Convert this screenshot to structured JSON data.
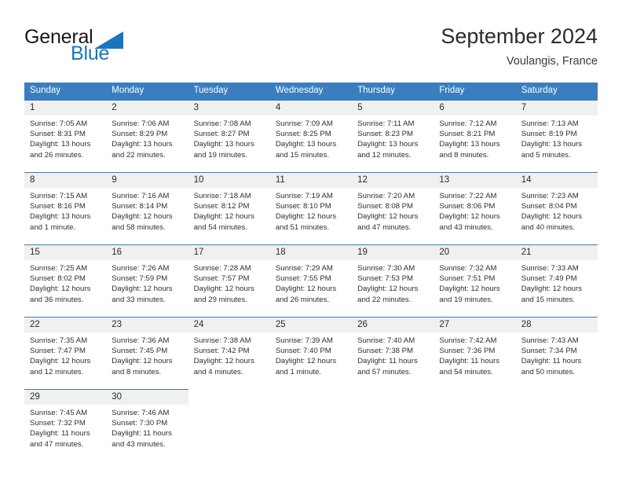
{
  "brand": {
    "name_part1": "General",
    "name_part2": "Blue",
    "logo_icon": "triangle-logo-icon",
    "accent_color": "#1b74bd"
  },
  "header": {
    "title": "September 2024",
    "location": "Voulangis, France"
  },
  "calendar": {
    "header_bg": "#3a7ebf",
    "daynum_bg": "#f0f0f0",
    "weekday_headers": [
      "Sunday",
      "Monday",
      "Tuesday",
      "Wednesday",
      "Thursday",
      "Friday",
      "Saturday"
    ],
    "weeks": [
      [
        {
          "day": "1",
          "sunrise": "Sunrise: 7:05 AM",
          "sunset": "Sunset: 8:31 PM",
          "daylight_line1": "Daylight: 13 hours",
          "daylight_line2": "and 26 minutes."
        },
        {
          "day": "2",
          "sunrise": "Sunrise: 7:06 AM",
          "sunset": "Sunset: 8:29 PM",
          "daylight_line1": "Daylight: 13 hours",
          "daylight_line2": "and 22 minutes."
        },
        {
          "day": "3",
          "sunrise": "Sunrise: 7:08 AM",
          "sunset": "Sunset: 8:27 PM",
          "daylight_line1": "Daylight: 13 hours",
          "daylight_line2": "and 19 minutes."
        },
        {
          "day": "4",
          "sunrise": "Sunrise: 7:09 AM",
          "sunset": "Sunset: 8:25 PM",
          "daylight_line1": "Daylight: 13 hours",
          "daylight_line2": "and 15 minutes."
        },
        {
          "day": "5",
          "sunrise": "Sunrise: 7:11 AM",
          "sunset": "Sunset: 8:23 PM",
          "daylight_line1": "Daylight: 13 hours",
          "daylight_line2": "and 12 minutes."
        },
        {
          "day": "6",
          "sunrise": "Sunrise: 7:12 AM",
          "sunset": "Sunset: 8:21 PM",
          "daylight_line1": "Daylight: 13 hours",
          "daylight_line2": "and 8 minutes."
        },
        {
          "day": "7",
          "sunrise": "Sunrise: 7:13 AM",
          "sunset": "Sunset: 8:19 PM",
          "daylight_line1": "Daylight: 13 hours",
          "daylight_line2": "and 5 minutes."
        }
      ],
      [
        {
          "day": "8",
          "sunrise": "Sunrise: 7:15 AM",
          "sunset": "Sunset: 8:16 PM",
          "daylight_line1": "Daylight: 13 hours",
          "daylight_line2": "and 1 minute."
        },
        {
          "day": "9",
          "sunrise": "Sunrise: 7:16 AM",
          "sunset": "Sunset: 8:14 PM",
          "daylight_line1": "Daylight: 12 hours",
          "daylight_line2": "and 58 minutes."
        },
        {
          "day": "10",
          "sunrise": "Sunrise: 7:18 AM",
          "sunset": "Sunset: 8:12 PM",
          "daylight_line1": "Daylight: 12 hours",
          "daylight_line2": "and 54 minutes."
        },
        {
          "day": "11",
          "sunrise": "Sunrise: 7:19 AM",
          "sunset": "Sunset: 8:10 PM",
          "daylight_line1": "Daylight: 12 hours",
          "daylight_line2": "and 51 minutes."
        },
        {
          "day": "12",
          "sunrise": "Sunrise: 7:20 AM",
          "sunset": "Sunset: 8:08 PM",
          "daylight_line1": "Daylight: 12 hours",
          "daylight_line2": "and 47 minutes."
        },
        {
          "day": "13",
          "sunrise": "Sunrise: 7:22 AM",
          "sunset": "Sunset: 8:06 PM",
          "daylight_line1": "Daylight: 12 hours",
          "daylight_line2": "and 43 minutes."
        },
        {
          "day": "14",
          "sunrise": "Sunrise: 7:23 AM",
          "sunset": "Sunset: 8:04 PM",
          "daylight_line1": "Daylight: 12 hours",
          "daylight_line2": "and 40 minutes."
        }
      ],
      [
        {
          "day": "15",
          "sunrise": "Sunrise: 7:25 AM",
          "sunset": "Sunset: 8:02 PM",
          "daylight_line1": "Daylight: 12 hours",
          "daylight_line2": "and 36 minutes."
        },
        {
          "day": "16",
          "sunrise": "Sunrise: 7:26 AM",
          "sunset": "Sunset: 7:59 PM",
          "daylight_line1": "Daylight: 12 hours",
          "daylight_line2": "and 33 minutes."
        },
        {
          "day": "17",
          "sunrise": "Sunrise: 7:28 AM",
          "sunset": "Sunset: 7:57 PM",
          "daylight_line1": "Daylight: 12 hours",
          "daylight_line2": "and 29 minutes."
        },
        {
          "day": "18",
          "sunrise": "Sunrise: 7:29 AM",
          "sunset": "Sunset: 7:55 PM",
          "daylight_line1": "Daylight: 12 hours",
          "daylight_line2": "and 26 minutes."
        },
        {
          "day": "19",
          "sunrise": "Sunrise: 7:30 AM",
          "sunset": "Sunset: 7:53 PM",
          "daylight_line1": "Daylight: 12 hours",
          "daylight_line2": "and 22 minutes."
        },
        {
          "day": "20",
          "sunrise": "Sunrise: 7:32 AM",
          "sunset": "Sunset: 7:51 PM",
          "daylight_line1": "Daylight: 12 hours",
          "daylight_line2": "and 19 minutes."
        },
        {
          "day": "21",
          "sunrise": "Sunrise: 7:33 AM",
          "sunset": "Sunset: 7:49 PM",
          "daylight_line1": "Daylight: 12 hours",
          "daylight_line2": "and 15 minutes."
        }
      ],
      [
        {
          "day": "22",
          "sunrise": "Sunrise: 7:35 AM",
          "sunset": "Sunset: 7:47 PM",
          "daylight_line1": "Daylight: 12 hours",
          "daylight_line2": "and 12 minutes."
        },
        {
          "day": "23",
          "sunrise": "Sunrise: 7:36 AM",
          "sunset": "Sunset: 7:45 PM",
          "daylight_line1": "Daylight: 12 hours",
          "daylight_line2": "and 8 minutes."
        },
        {
          "day": "24",
          "sunrise": "Sunrise: 7:38 AM",
          "sunset": "Sunset: 7:42 PM",
          "daylight_line1": "Daylight: 12 hours",
          "daylight_line2": "and 4 minutes."
        },
        {
          "day": "25",
          "sunrise": "Sunrise: 7:39 AM",
          "sunset": "Sunset: 7:40 PM",
          "daylight_line1": "Daylight: 12 hours",
          "daylight_line2": "and 1 minute."
        },
        {
          "day": "26",
          "sunrise": "Sunrise: 7:40 AM",
          "sunset": "Sunset: 7:38 PM",
          "daylight_line1": "Daylight: 11 hours",
          "daylight_line2": "and 57 minutes."
        },
        {
          "day": "27",
          "sunrise": "Sunrise: 7:42 AM",
          "sunset": "Sunset: 7:36 PM",
          "daylight_line1": "Daylight: 11 hours",
          "daylight_line2": "and 54 minutes."
        },
        {
          "day": "28",
          "sunrise": "Sunrise: 7:43 AM",
          "sunset": "Sunset: 7:34 PM",
          "daylight_line1": "Daylight: 11 hours",
          "daylight_line2": "and 50 minutes."
        }
      ],
      [
        {
          "day": "29",
          "sunrise": "Sunrise: 7:45 AM",
          "sunset": "Sunset: 7:32 PM",
          "daylight_line1": "Daylight: 11 hours",
          "daylight_line2": "and 47 minutes."
        },
        {
          "day": "30",
          "sunrise": "Sunrise: 7:46 AM",
          "sunset": "Sunset: 7:30 PM",
          "daylight_line1": "Daylight: 11 hours",
          "daylight_line2": "and 43 minutes."
        },
        {
          "day": "",
          "sunrise": "",
          "sunset": "",
          "daylight_line1": "",
          "daylight_line2": ""
        },
        {
          "day": "",
          "sunrise": "",
          "sunset": "",
          "daylight_line1": "",
          "daylight_line2": ""
        },
        {
          "day": "",
          "sunrise": "",
          "sunset": "",
          "daylight_line1": "",
          "daylight_line2": ""
        },
        {
          "day": "",
          "sunrise": "",
          "sunset": "",
          "daylight_line1": "",
          "daylight_line2": ""
        },
        {
          "day": "",
          "sunrise": "",
          "sunset": "",
          "daylight_line1": "",
          "daylight_line2": ""
        }
      ]
    ]
  }
}
